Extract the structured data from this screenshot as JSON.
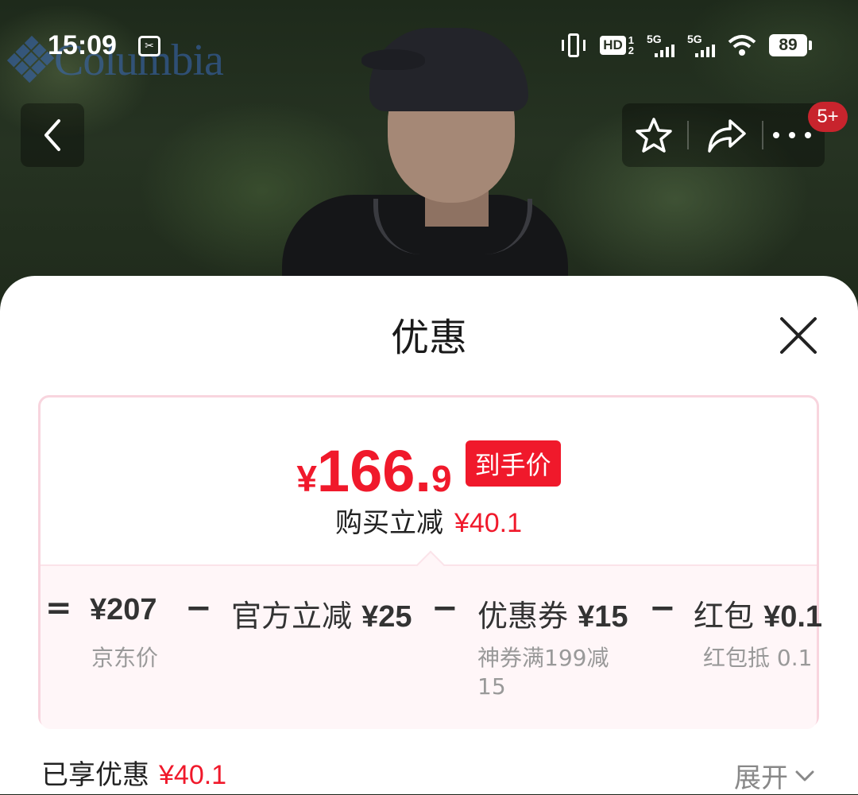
{
  "status_bar": {
    "time": "15:09",
    "hd_label": "HD",
    "hd_sub_top": "1",
    "hd_sub_bottom": "2",
    "signal1_label": "5G",
    "signal2_label": "5G",
    "battery": "89"
  },
  "hero": {
    "brand_logo_text": "Columbia",
    "notification_badge": "5+"
  },
  "sheet": {
    "title": "优惠",
    "final_price": {
      "currency": "¥",
      "integer": "166.",
      "decimal": "9",
      "tag": "到手价"
    },
    "savings_label": "购买立减",
    "savings_amount": "¥40.1",
    "breakdown": {
      "equals": "=",
      "items": [
        {
          "label": "",
          "value": "¥207",
          "sub": "京东价"
        },
        {
          "label": "官方立减",
          "value": "¥25",
          "sub": ""
        },
        {
          "label": "优惠券",
          "value": "¥15",
          "sub": "神券满199减15"
        },
        {
          "label": "红包",
          "value": "¥0.1",
          "sub": "红包抵 0.1"
        }
      ],
      "minus": "−"
    },
    "enjoyed_label": "已享优惠",
    "enjoyed_amount": "¥40.1",
    "expand_label": "展开"
  },
  "colors": {
    "accent_red": "#f0192b",
    "card_border": "#f8d5de",
    "breakdown_bg": "#fff6f8"
  },
  "icons": {
    "back": "chevron-left-icon",
    "favorite": "star-icon",
    "share": "share-icon",
    "more": "more-dots-icon",
    "close": "close-icon",
    "expand": "chevron-down-icon"
  }
}
